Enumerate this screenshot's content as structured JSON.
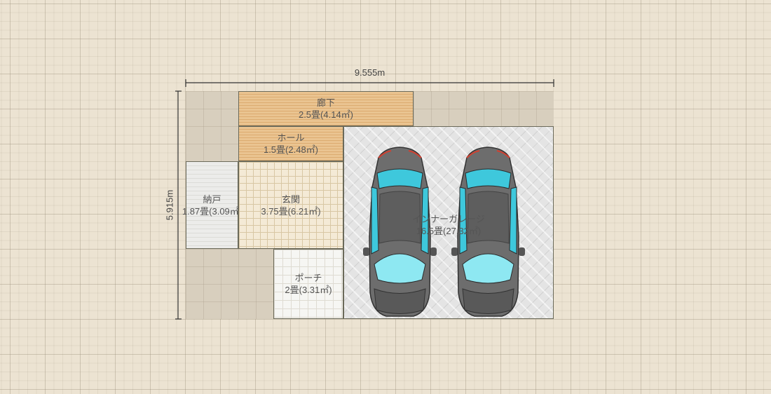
{
  "dimensions": {
    "width": "9.555m",
    "height": "5.915m"
  },
  "rooms": {
    "hallway": {
      "name": "廊下",
      "area": "2.5畳(4.14㎡)"
    },
    "hall": {
      "name": "ホール",
      "area": "1.5畳(2.48㎡)"
    },
    "storage": {
      "name": "納戸",
      "area": "1.87畳(3.09㎡)"
    },
    "entrance": {
      "name": "玄関",
      "area": "3.75畳(6.21㎡)"
    },
    "porch": {
      "name": "ポーチ",
      "area": "2畳(3.31㎡)"
    },
    "garage": {
      "name": "インナーガレージ",
      "area": "16.5畳(27.32㎡)"
    }
  },
  "icons": [
    "car-icon",
    "car-icon"
  ],
  "colors": {
    "background": "#ece3d2",
    "wood_floor": "#e9bd86",
    "car_body": "#6d6d6d",
    "car_glass": "#3ec8dc"
  }
}
